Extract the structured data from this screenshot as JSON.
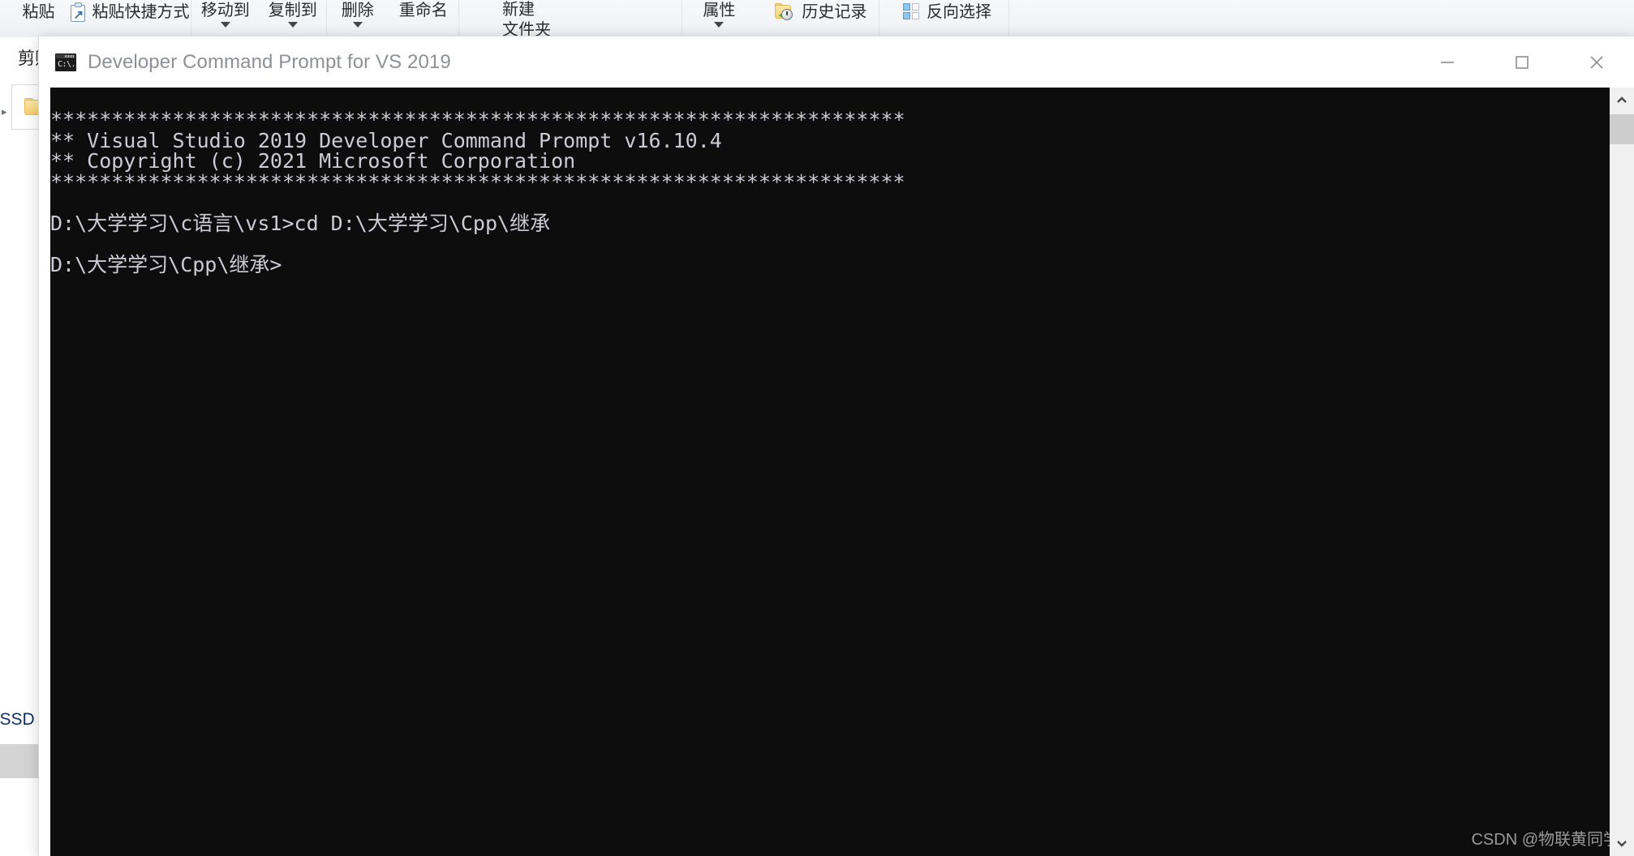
{
  "explorer": {
    "ribbon_groups": [
      {
        "name": "clipboard",
        "caption": "剪贴板",
        "buttons": [
          {
            "label": "粘贴",
            "icon": "",
            "caret": false
          },
          {
            "label": "粘贴快捷方式",
            "icon": "clipboard-shortcut-icon",
            "caret": false
          }
        ]
      },
      {
        "name": "organize",
        "caption": "",
        "buttons": [
          {
            "label": "移动到",
            "icon": "",
            "caret": true
          },
          {
            "label": "复制到",
            "icon": "",
            "caret": true
          }
        ]
      },
      {
        "name": "delete-rename",
        "caption": "",
        "buttons": [
          {
            "label": "删除",
            "icon": "",
            "caret": true
          },
          {
            "label": "重命名",
            "icon": "",
            "caret": false
          }
        ]
      },
      {
        "name": "new",
        "caption": "",
        "buttons": [
          {
            "label_line1": "新建",
            "label_line2": "文件夹",
            "icon": "",
            "caret": false
          }
        ]
      },
      {
        "name": "open",
        "caption": "",
        "buttons": [
          {
            "label": "属性",
            "icon": "",
            "caret": true
          },
          {
            "label": "历史记录",
            "icon": "folder-history-icon",
            "caret": false
          }
        ]
      },
      {
        "name": "select",
        "caption": "",
        "buttons": [
          {
            "label": "反向选择",
            "icon": "invert-selection-icon",
            "caret": false
          }
        ]
      }
    ],
    "tree": {
      "partial_item_text": "s-SSD",
      "selected_item_text": ")"
    }
  },
  "console_window": {
    "title": "Developer Command Prompt for VS 2019",
    "icon": "command-prompt-icon",
    "window_controls": {
      "minimize": "minimize-icon",
      "maximize": "maximize-icon",
      "close": "close-icon"
    },
    "scrollbar": {
      "up_arrow": "chevron-up-icon",
      "down_arrow": "chevron-down-icon"
    },
    "colors": {
      "background": "#0d0d0d",
      "foreground": "#ccccd6",
      "titlebar_text": "#8d9195"
    },
    "terminal_text": "**********************************************************************\n** Visual Studio 2019 Developer Command Prompt v16.10.4\n** Copyright (c) 2021 Microsoft Corporation\n**********************************************************************\n\nD:\\大学学习\\c语言\\vs1>cd D:\\大学学习\\Cpp\\继承\n\nD:\\大学学习\\Cpp\\继承>",
    "watermark": "CSDN @物联黄同学"
  }
}
